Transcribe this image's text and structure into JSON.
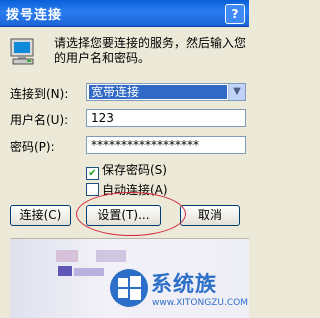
{
  "window": {
    "title": "拨号连接",
    "help_label": "?"
  },
  "intro": "请选择您要连接的服务，然后输入您的用户名和密码。",
  "form": {
    "connect_to_label": "连接到(N):",
    "connect_to_value": "宽带连接",
    "username_label": "用户名(U):",
    "username_value": "123",
    "password_label": "密码(P):",
    "password_value": "******************",
    "save_password_label": "保存密码(S)",
    "save_password_checked": true,
    "auto_connect_label": "自动连接(A)",
    "auto_connect_checked": false
  },
  "buttons": {
    "connect": "连接(C)",
    "settings": "设置(T)...",
    "cancel": "取消"
  },
  "watermark": {
    "text": "系统族",
    "url": "www.XITONGZU.COM"
  },
  "colors": {
    "title_bar": "#1c64d6",
    "selection": "#316ac5",
    "annotation": "#d3283a"
  }
}
